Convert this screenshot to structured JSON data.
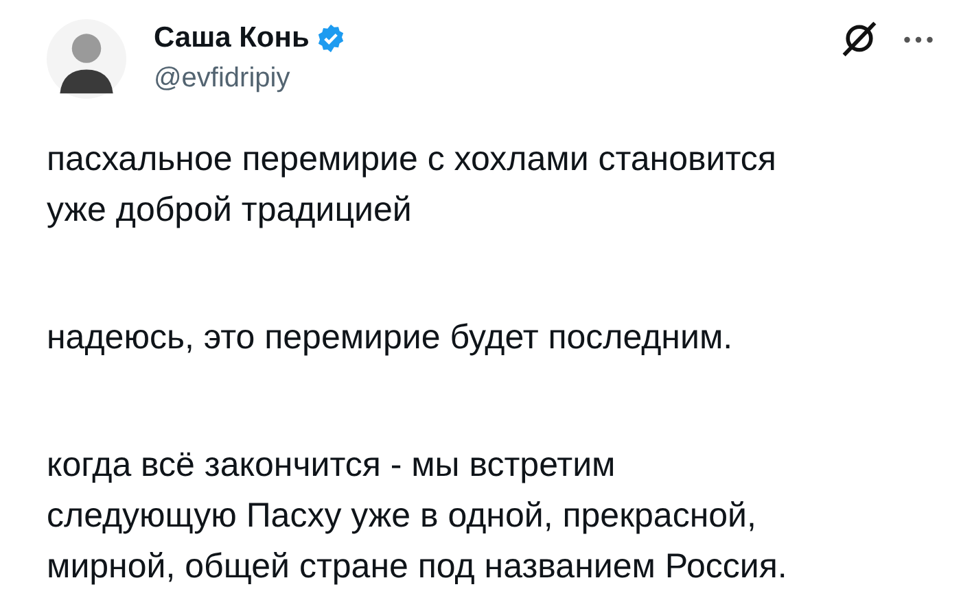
{
  "author": {
    "name": "Саша Конь",
    "handle": "@evfidripiy",
    "verified": true
  },
  "paragraphs": [
    "пасхальное перемирие с хохлами становится\nуже доброй традицией",
    "надеюсь, это перемирие будет последним.",
    "когда всё закончится - мы встретим\nследующую Пасху уже в одной, прекрасной,\nмирной, общей стране под названием Россия."
  ]
}
